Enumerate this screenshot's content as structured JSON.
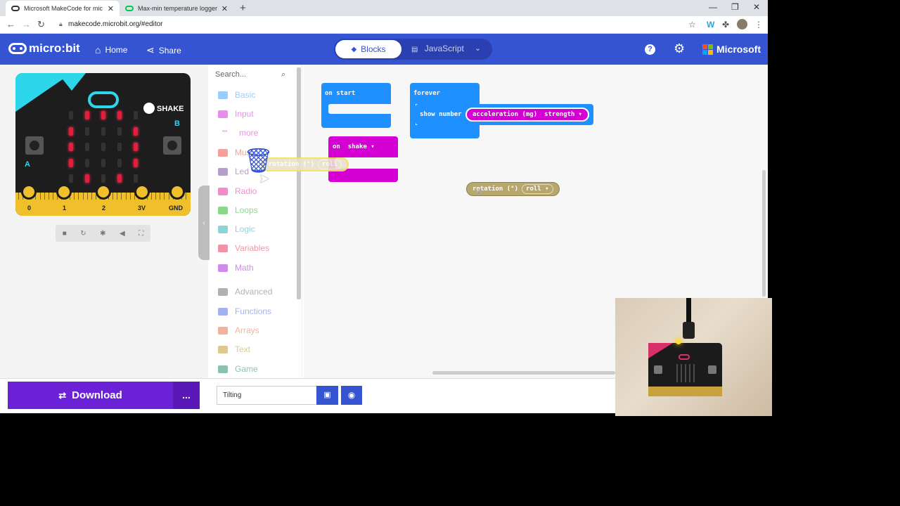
{
  "browser": {
    "tabs": [
      {
        "title": "Microsoft MakeCode for mic"
      },
      {
        "title": "Max-min temperature logger | m"
      }
    ],
    "url": "makecode.microbit.org/#editor"
  },
  "header": {
    "logo": "micro:bit",
    "home_label": "Home",
    "share_label": "Share",
    "blocks_label": "Blocks",
    "javascript_label": "JavaScript",
    "microsoft_label": "Microsoft"
  },
  "simulator": {
    "gesture_label": "SHAKE",
    "button_a": "A",
    "button_b": "B",
    "pins": [
      "0",
      "1",
      "2",
      "3V",
      "GND"
    ]
  },
  "toolbox": {
    "search_placeholder": "Search...",
    "categories": [
      {
        "label": "Basic",
        "color": "#1e90ff"
      },
      {
        "label": "Input",
        "color": "#d400d4"
      },
      {
        "label": "more",
        "color": "#d400d4"
      },
      {
        "label": "Music",
        "color": "#e63022"
      },
      {
        "label": "Led",
        "color": "#5c2d91"
      },
      {
        "label": "Radio",
        "color": "#e3008c"
      },
      {
        "label": "Loops",
        "color": "#00aa00"
      },
      {
        "label": "Logic",
        "color": "#00a4a6"
      },
      {
        "label": "Variables",
        "color": "#dc143c"
      },
      {
        "label": "Math",
        "color": "#9400d3"
      },
      {
        "label": "Advanced",
        "color": "#555555"
      },
      {
        "label": "Functions",
        "color": "#3455db"
      },
      {
        "label": "Arrays",
        "color": "#e65722"
      },
      {
        "label": "Text",
        "color": "#b8860b"
      },
      {
        "label": "Game",
        "color": "#007a4b"
      }
    ]
  },
  "workspace": {
    "on_start": "on start",
    "forever": "forever",
    "show_number": "show number",
    "acceleration_block": "acceleration (mg)",
    "acceleration_dropdown": "strength",
    "on_gesture": "on",
    "on_gesture_dropdown": "shake",
    "rotation_block": "rotation (°)",
    "rotation_dropdown": "roll"
  },
  "bottombar": {
    "download_label": "Download",
    "more_label": "...",
    "project_name": "Tilting"
  },
  "colors": {
    "header": "#3454d1",
    "download": "#6b21d6",
    "basic_blocks": "#1e90ff",
    "input_blocks": "#d400d4",
    "rotation_block": "#b7a76c"
  }
}
